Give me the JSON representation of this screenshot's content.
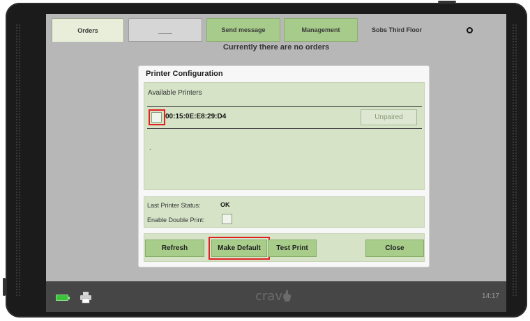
{
  "tabs": [
    {
      "label": "Orders"
    },
    {
      "label": ""
    },
    {
      "label": "Send message"
    },
    {
      "label": "Management"
    },
    {
      "label": "Sobs Third Floor"
    }
  ],
  "orders_notice": "Currently there are no orders",
  "dialog": {
    "title": "Printer Configuration",
    "available_printers_label": "Available Printers",
    "printers": [
      {
        "address": "00:15:0E:E8:29:D4",
        "pair_status": "Unpaired"
      }
    ],
    "placeholder_mark": ".",
    "last_status_label": "Last Printer Status:",
    "last_status_value": "OK",
    "double_print_label": "Enable Double Print:",
    "buttons": {
      "refresh": "Refresh",
      "make_default": "Make Default",
      "test_print": "Test Print",
      "close": "Close"
    }
  },
  "bottombar": {
    "logo": "crave",
    "time": "14:17"
  },
  "colors": {
    "accent_green": "#a8cd8b",
    "panel_green": "#d6e3c7",
    "highlight_red": "#e02020"
  },
  "icons": [
    "battery-icon",
    "printer-icon",
    "circle-icon",
    "crave-logo-icon"
  ]
}
